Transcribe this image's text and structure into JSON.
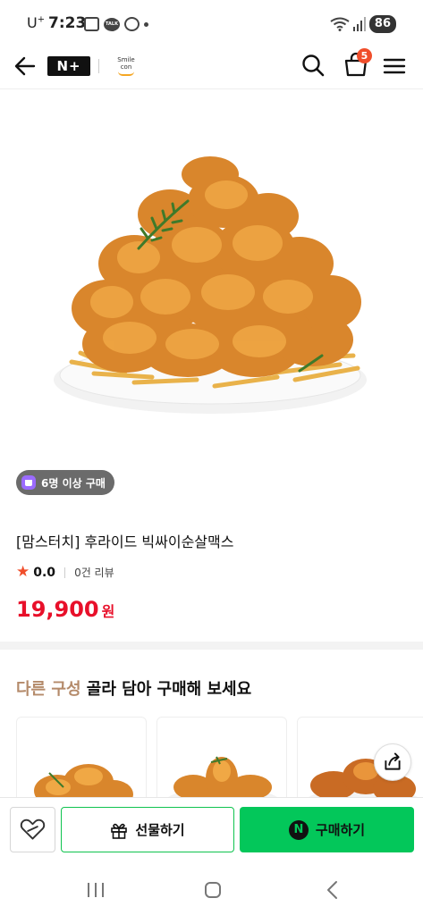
{
  "status_bar": {
    "carrier": "U",
    "carrier_sup": "+",
    "time": "7:23",
    "battery": "86",
    "talk_label": "TALK"
  },
  "header": {
    "logo_text": "N+",
    "smilecon_text": "Smile con",
    "cart_count": "5",
    "icons": [
      "back-arrow-icon",
      "search-icon",
      "cart-icon",
      "menu-icon"
    ]
  },
  "product": {
    "badge": "6명 이상 구매",
    "title": "[맘스터치] 후라이드 빅싸이순살맥스",
    "rating": "0.0",
    "review_count": "0건 리뷰",
    "price": "19,900",
    "price_unit": "원"
  },
  "related": {
    "title_accent": "다른 구성",
    "title_rest": " 골라 담아 구매해 보세요"
  },
  "bottom_bar": {
    "gift_label": "선물하기",
    "buy_label": "구매하기",
    "npay_letter": "N"
  },
  "colors": {
    "price_red": "#e8102a",
    "naver_green": "#03c75a",
    "badge_orange": "#f04e2b",
    "accent_brown": "#b48a6a"
  }
}
